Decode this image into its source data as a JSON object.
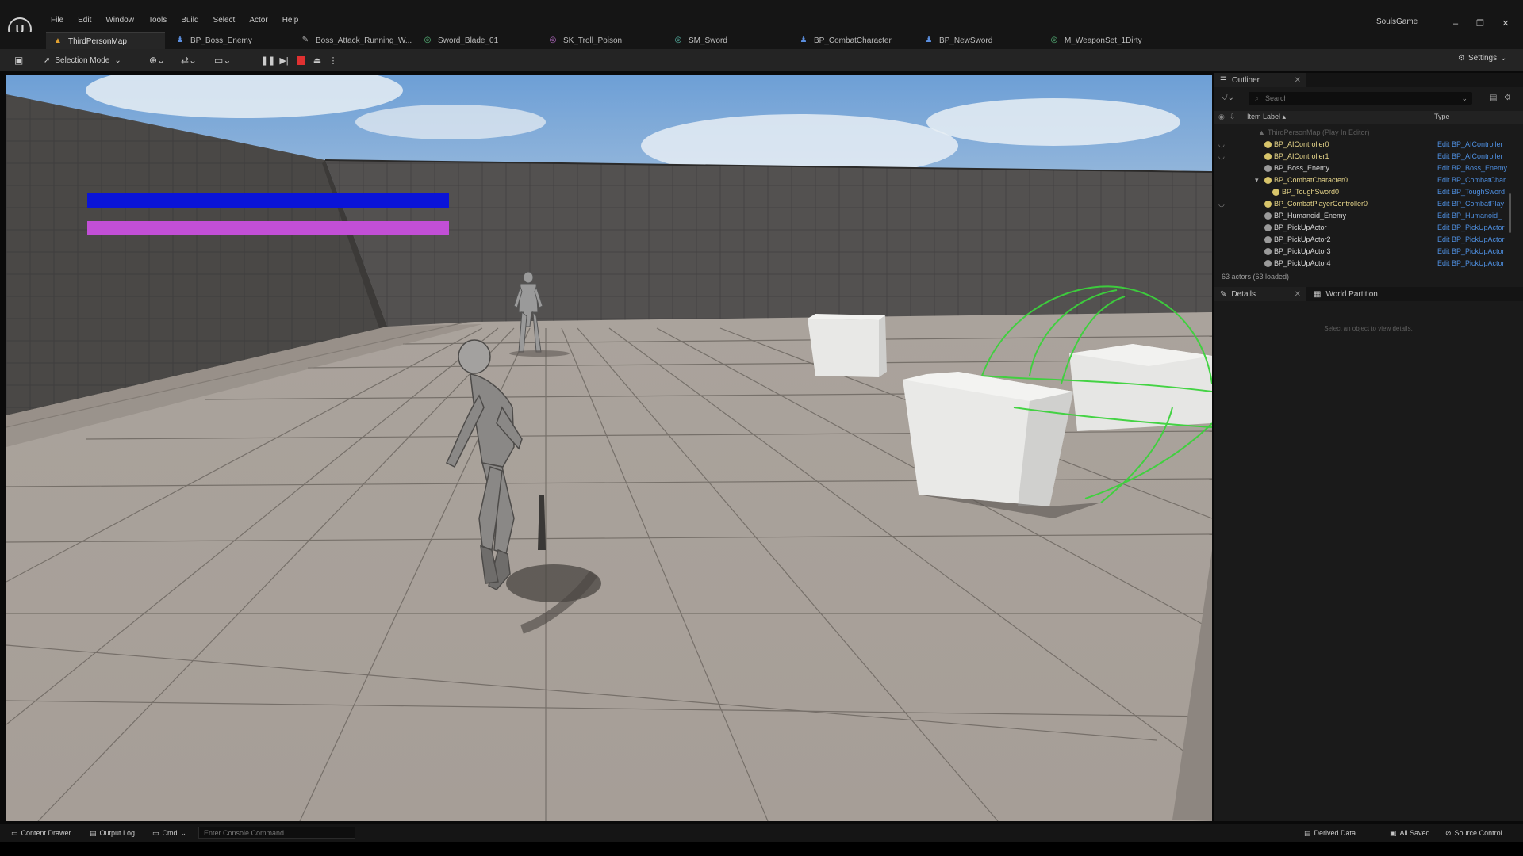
{
  "app": {
    "logo": "U",
    "project_name": "SoulsGame",
    "window_buttons": [
      "–",
      "❐",
      "✕"
    ]
  },
  "menu": [
    "File",
    "Edit",
    "Window",
    "Tools",
    "Build",
    "Select",
    "Actor",
    "Help"
  ],
  "tabs": [
    {
      "label": "ThirdPersonMap",
      "icon": "level-icon",
      "color": "#e0a030",
      "active": true
    },
    {
      "label": "BP_Boss_Enemy",
      "icon": "blueprint-icon",
      "color": "#5b8fe0"
    },
    {
      "label": "Boss_Attack_Running_W...",
      "icon": "animation-icon",
      "color": "#b0b0b0"
    },
    {
      "label": "Sword_Blade_01",
      "icon": "texture-icon",
      "color": "#5ac080"
    },
    {
      "label": "SK_Troll_Poison",
      "icon": "skeletal-mesh-icon",
      "color": "#c070d0"
    },
    {
      "label": "SM_Sword",
      "icon": "static-mesh-icon",
      "color": "#5ac0b0"
    },
    {
      "label": "BP_CombatCharacter",
      "icon": "blueprint-icon",
      "color": "#5b8fe0"
    },
    {
      "label": "BP_NewSword",
      "icon": "blueprint-icon",
      "color": "#5b8fe0"
    },
    {
      "label": "M_WeaponSet_1Dirty",
      "icon": "material-icon",
      "color": "#5ac080"
    }
  ],
  "toolbar": {
    "selection_mode": "Selection Mode",
    "settings": "Settings"
  },
  "hud": {
    "health_color": "#0a14d8",
    "stamina_color": "#c24fd6"
  },
  "outliner": {
    "tab_label": "Outliner",
    "search_placeholder": "Search",
    "col_label": "Item Label ▴",
    "col_type": "Type",
    "root_label": "ThirdPersonMap (Play In Editor)",
    "rows": [
      {
        "label": "BP_AIController0",
        "type": "Edit BP_AIController",
        "indent": 0,
        "expander": false,
        "eye": true,
        "highlight": true
      },
      {
        "label": "BP_AIController1",
        "type": "Edit BP_AIController",
        "indent": 0,
        "expander": false,
        "eye": true,
        "highlight": true
      },
      {
        "label": "BP_Boss_Enemy",
        "type": "Edit BP_Boss_Enemy",
        "indent": 0,
        "expander": false,
        "eye": false,
        "highlight": false
      },
      {
        "label": "BP_CombatCharacter0",
        "type": "Edit BP_CombatChar",
        "indent": 0,
        "expander": true,
        "eye": false,
        "highlight": true
      },
      {
        "label": "BP_ToughSword0",
        "type": "Edit BP_ToughSword",
        "indent": 1,
        "expander": false,
        "eye": false,
        "highlight": true
      },
      {
        "label": "BP_CombatPlayerController0",
        "type": "Edit BP_CombatPlay",
        "indent": 0,
        "expander": false,
        "eye": true,
        "highlight": true
      },
      {
        "label": "BP_Humanoid_Enemy",
        "type": "Edit BP_Humanoid_",
        "indent": 0,
        "expander": false,
        "eye": false,
        "highlight": false
      },
      {
        "label": "BP_PickUpActor",
        "type": "Edit BP_PickUpActor",
        "indent": 0,
        "expander": false,
        "eye": false,
        "highlight": false
      },
      {
        "label": "BP_PickUpActor2",
        "type": "Edit BP_PickUpActor",
        "indent": 0,
        "expander": false,
        "eye": false,
        "highlight": false
      },
      {
        "label": "BP_PickUpActor3",
        "type": "Edit BP_PickUpActor",
        "indent": 0,
        "expander": false,
        "eye": false,
        "highlight": false
      },
      {
        "label": "BP_PickUpActor4",
        "type": "Edit BP_PickUpActor",
        "indent": 0,
        "expander": false,
        "eye": false,
        "highlight": false
      }
    ],
    "status": "63 actors (63 loaded)"
  },
  "details": {
    "tab_label": "Details",
    "world_partition_label": "World Partition",
    "empty_message": "Select an object to view details."
  },
  "statusbar": {
    "content_drawer": "Content Drawer",
    "output_log": "Output Log",
    "cmd": "Cmd",
    "console_placeholder": "Enter Console Command",
    "derived_data": "Derived Data",
    "all_saved": "All Saved",
    "source_control": "Source Control"
  }
}
